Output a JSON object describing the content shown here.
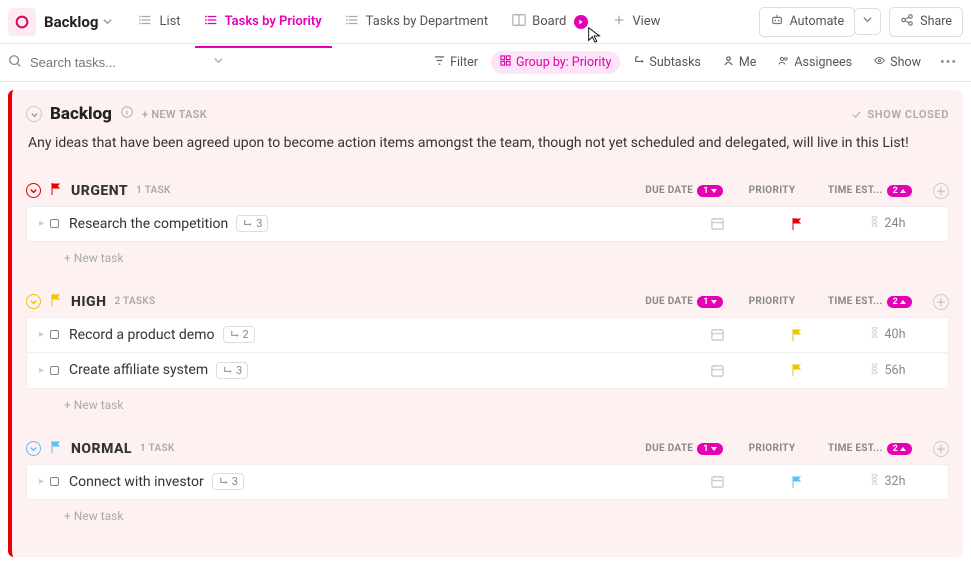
{
  "header": {
    "title": "Backlog",
    "views": {
      "list": "List",
      "tasks_by_priority": "Tasks by Priority",
      "tasks_by_department": "Tasks by Department",
      "board": "Board",
      "add_view": "View"
    },
    "automate": "Automate",
    "share": "Share"
  },
  "toolbar": {
    "search_placeholder": "Search tasks...",
    "filter": "Filter",
    "group_by": "Group by: Priority",
    "subtasks": "Subtasks",
    "me": "Me",
    "assignees": "Assignees",
    "show": "Show"
  },
  "panel": {
    "title": "Backlog",
    "new_task": "+ NEW TASK",
    "show_closed": "SHOW CLOSED",
    "description": "Any ideas that have been agreed upon to become action items amongst the team, though not yet scheduled and delegated, will live in this List!"
  },
  "columns": {
    "due_date": "DUE DATE",
    "due_date_badge": "1",
    "priority": "PRIORITY",
    "time_est": "TIME EST...",
    "time_est_badge": "2"
  },
  "groups": [
    {
      "key": "urgent",
      "label": "URGENT",
      "count_label": "1 TASK",
      "flag_color": "#e40000",
      "tasks": [
        {
          "title": "Research the competition",
          "subtasks": "3",
          "time": "24h",
          "prio_color": "#e40000"
        }
      ]
    },
    {
      "key": "high",
      "label": "HIGH",
      "count_label": "2 TASKS",
      "flag_color": "#f0c400",
      "tasks": [
        {
          "title": "Record a product demo",
          "subtasks": "2",
          "time": "40h",
          "prio_color": "#f0c400"
        },
        {
          "title": "Create affiliate system",
          "subtasks": "3",
          "time": "56h",
          "prio_color": "#f0c400"
        }
      ]
    },
    {
      "key": "normal",
      "label": "NORMAL",
      "count_label": "1 TASK",
      "flag_color": "#58c4f4",
      "tasks": [
        {
          "title": "Connect with investor",
          "subtasks": "3",
          "time": "32h",
          "prio_color": "#58c4f4"
        }
      ]
    }
  ],
  "strings": {
    "new_task_row": "+ New task"
  }
}
